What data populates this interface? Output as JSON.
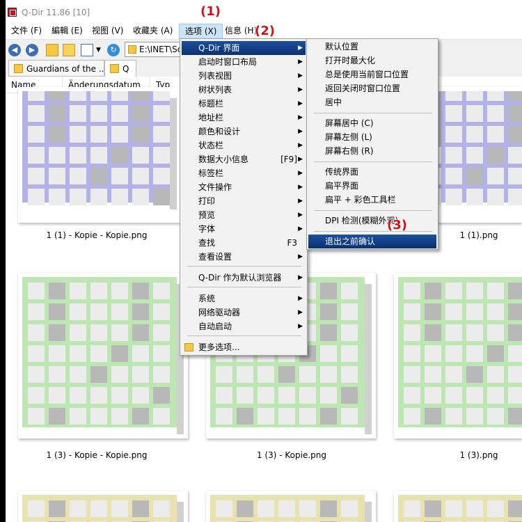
{
  "window": {
    "title": "Q-Dir 11.86 [10]"
  },
  "menubar": {
    "items": [
      {
        "label": "文件 (F)"
      },
      {
        "label": "編輯 (E)"
      },
      {
        "label": "视图 (V)"
      },
      {
        "label": "收藏夹 (A)"
      },
      {
        "label": "选项 (X)"
      },
      {
        "label": "信息 (H)"
      }
    ]
  },
  "toolbar": {
    "address": "E:\\INET\\So"
  },
  "tabs": [
    {
      "label": "Guardians of the ..."
    },
    {
      "label": "Q"
    }
  ],
  "columns": [
    {
      "label": "Name"
    },
    {
      "label": "Änderungsdatum"
    },
    {
      "label": "Typ"
    }
  ],
  "files": [
    {
      "label": "1 (1) - Kopie - Kopie.png"
    },
    {
      "label": "1 (1).png"
    },
    {
      "label": "1 (3) - Kopie - Kopie.png"
    },
    {
      "label": "1 (3) - Kopie.png"
    },
    {
      "label": "1 (3).png"
    }
  ],
  "options_menu": {
    "items": [
      {
        "label": "Q-Dir 界面",
        "shortcut": "",
        "submenu": true
      },
      {
        "label": "启动时窗口布局",
        "shortcut": "",
        "submenu": true
      },
      {
        "label": "列表视图",
        "shortcut": "",
        "submenu": true
      },
      {
        "label": "树状列表",
        "shortcut": "",
        "submenu": true
      },
      {
        "label": "标题栏",
        "shortcut": "",
        "submenu": true
      },
      {
        "label": "地址栏",
        "shortcut": "",
        "submenu": true
      },
      {
        "label": "颜色和设计",
        "shortcut": "",
        "submenu": true
      },
      {
        "label": "状态栏",
        "shortcut": "",
        "submenu": true
      },
      {
        "label": "数据大小信息",
        "shortcut": "[F9]",
        "submenu": true
      },
      {
        "label": "标签栏",
        "shortcut": "",
        "submenu": true
      },
      {
        "label": "文件操作",
        "shortcut": "",
        "submenu": true
      },
      {
        "label": "打印",
        "shortcut": "",
        "submenu": true
      },
      {
        "label": "预览",
        "shortcut": "",
        "submenu": true
      },
      {
        "label": "字体",
        "shortcut": "",
        "submenu": true
      },
      {
        "label": "查找",
        "shortcut": "F3",
        "submenu": false
      },
      {
        "label": "查看设置",
        "shortcut": "",
        "submenu": true
      },
      {
        "label": "Q-Dir 作为默认浏览器",
        "shortcut": "",
        "submenu": true
      },
      {
        "label": "系统",
        "shortcut": "",
        "submenu": true
      },
      {
        "label": "网络驱动器",
        "shortcut": "",
        "submenu": true
      },
      {
        "label": "自动启动",
        "shortcut": "",
        "submenu": true
      },
      {
        "label": "更多选项...",
        "shortcut": "",
        "submenu": false
      }
    ]
  },
  "submenu": {
    "items": [
      {
        "label": "默认位置"
      },
      {
        "label": "打开时最大化"
      },
      {
        "label": "总是使用当前窗口位置"
      },
      {
        "label": "返回关闭时窗口位置"
      },
      {
        "label": "居中"
      },
      {
        "label": "屏幕居中 (C)"
      },
      {
        "label": "屏幕左侧 (L)"
      },
      {
        "label": "屏幕右侧 (R)"
      },
      {
        "label": "传统界面"
      },
      {
        "label": "扁平界面"
      },
      {
        "label": "扁平 + 彩色工具栏"
      },
      {
        "label": "DPI 检测(模糊外观)"
      },
      {
        "label": "退出之前确认"
      }
    ]
  },
  "callouts": [
    "(1)",
    "(2)",
    "(3)"
  ],
  "colors": {
    "highlight": "#0a3270",
    "callout": "#c8141a",
    "thumb_purple": "#b3b1e6",
    "thumb_green": "#bde6b4",
    "thumb_yellow": "#e8e2b0",
    "cell_light": "#ececec",
    "cell_dark": "#b8b8b8"
  }
}
